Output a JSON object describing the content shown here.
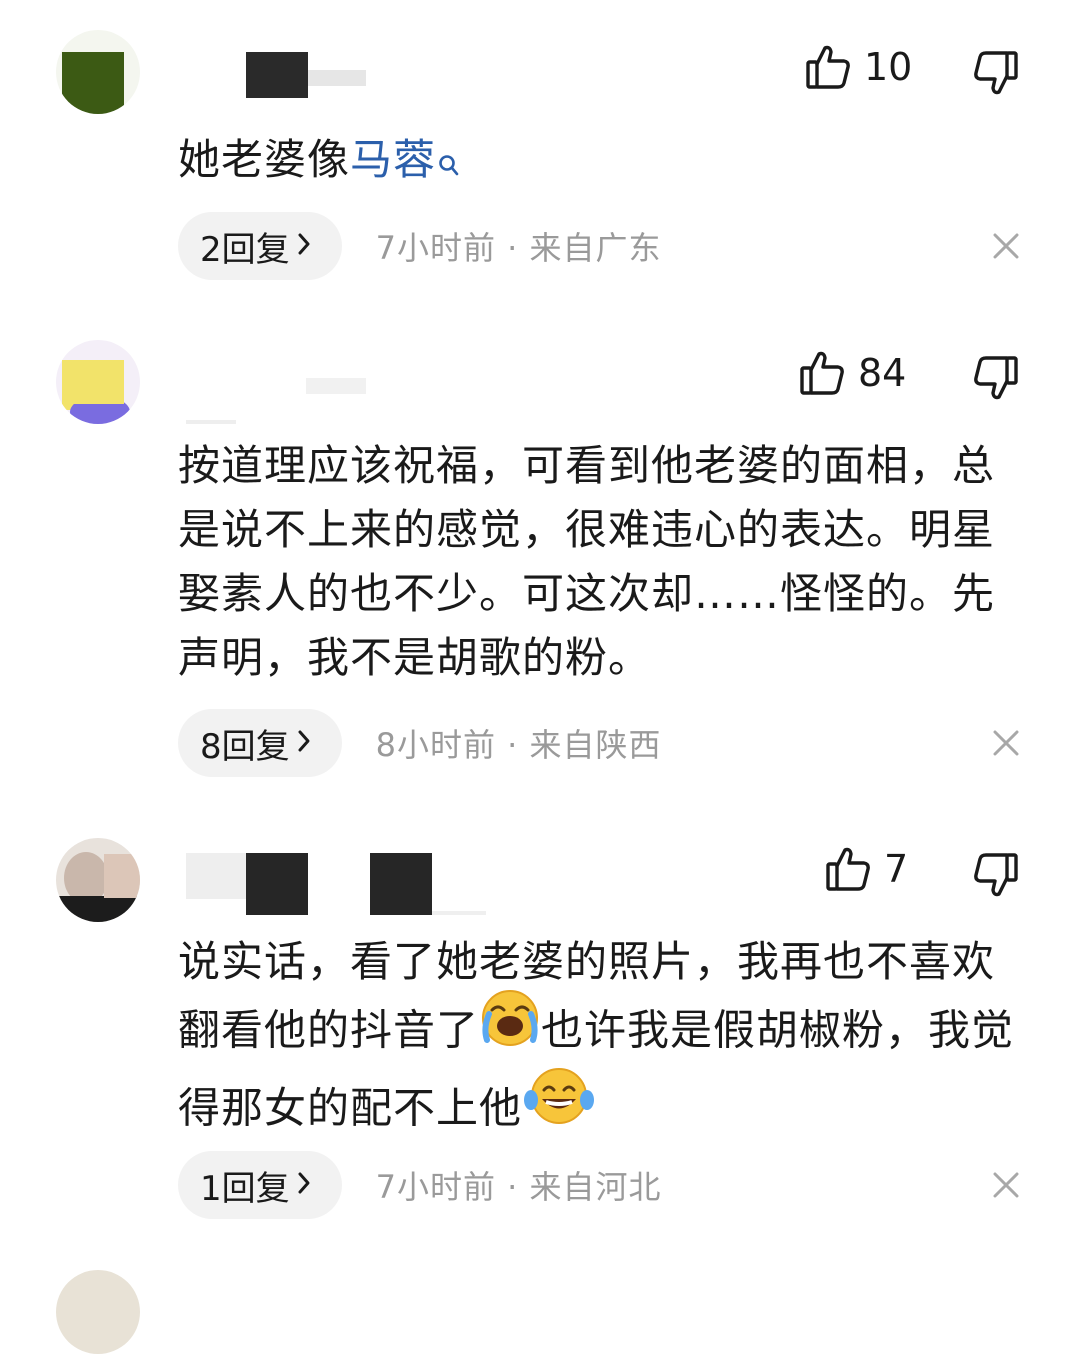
{
  "comments": [
    {
      "likes": "10",
      "text_parts": [
        "她老婆像",
        "马蓉"
      ],
      "replies_label": "2回复",
      "time_location": "7小时前 · 来自广东"
    },
    {
      "likes": "84",
      "text": "按道理应该祝福，可看到他老婆的面相，总是说不上来的感觉，很难违心的表达。明星娶素人的也不少。可这次却……怪怪的。先声明，我不是胡歌的粉。",
      "replies_label": "8回复",
      "time_location": "8小时前 · 来自陕西"
    },
    {
      "likes": "7",
      "text_parts": [
        "说实话，看了她老婆的照片，我再也不喜欢翻看他的抖音了",
        "也许我是假胡椒粉，我觉得那女的配不上他"
      ],
      "replies_label": "1回复",
      "time_location": "7小时前 · 来自河北"
    }
  ],
  "icons": {
    "like": "thumbs-up-icon",
    "dislike": "thumbs-down-icon",
    "chevron": "chevron-right-icon",
    "close": "close-icon",
    "search": "search-icon",
    "emoji1": "loudly-crying-face-emoji",
    "emoji2": "tears-of-joy-emoji"
  },
  "colors": {
    "link": "#2b5fab",
    "meta_text": "#9a9a9a",
    "reply_bg": "#f2f2f2"
  }
}
